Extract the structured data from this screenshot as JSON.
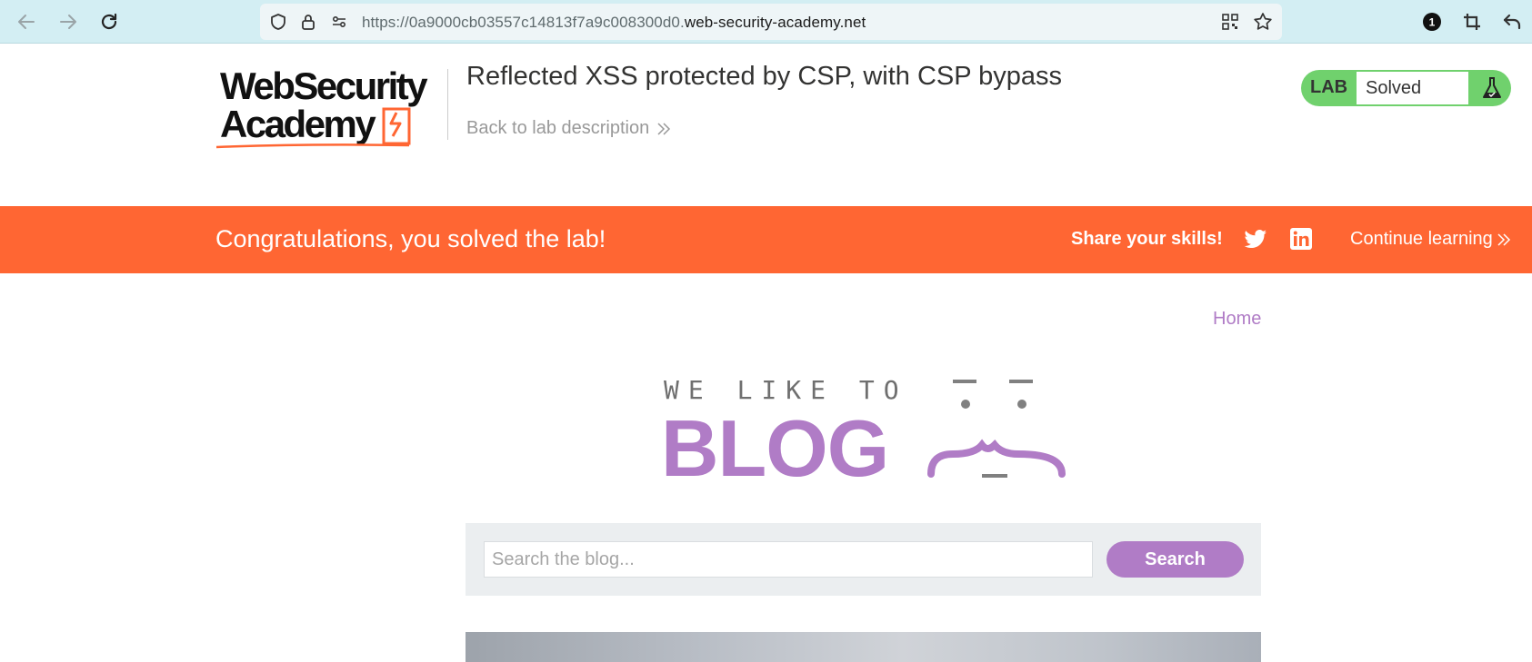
{
  "browser": {
    "url_prefix": "https://0a9000cb03557c14813f7a9c008300d0.",
    "url_host": "web-security-academy.net",
    "extension_badge": "1"
  },
  "lab_header": {
    "logo_line1": "WebSecurity",
    "logo_line2": "Academy",
    "title": "Reflected XSS protected by CSP, with CSP bypass",
    "back_link": "Back to lab description",
    "lab_tag": "LAB",
    "status": "Solved"
  },
  "banner": {
    "message": "Congratulations, you solved the lab!",
    "share_label": "Share your skills!",
    "continue_label": "Continue learning"
  },
  "blog": {
    "home_link": "Home",
    "tagline": "WE LIKE TO",
    "wordmark": "BLOG",
    "search_placeholder": "Search the blog...",
    "search_button": "Search"
  },
  "colors": {
    "browser_bar": "#d3eef3",
    "banner_orange": "#ff6633",
    "status_green": "#70d16d",
    "blog_purple": "#b07cc6"
  },
  "icons": [
    "back-arrow-icon",
    "forward-arrow-icon",
    "reload-icon",
    "shield-icon",
    "lock-icon",
    "permissions-icon",
    "qr-code-icon",
    "star-icon",
    "extension-icon",
    "crop-icon",
    "undo-icon",
    "chevrons-right-icon",
    "flask-icon",
    "twitter-icon",
    "linkedin-icon"
  ]
}
